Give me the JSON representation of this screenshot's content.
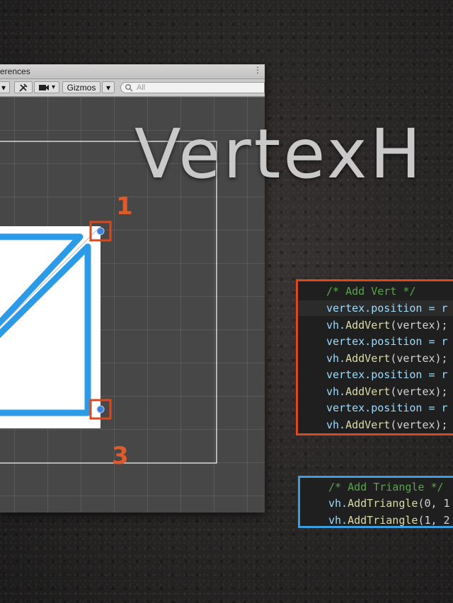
{
  "window": {
    "tab_title": "erences",
    "tab_menu_glyph": "⋮"
  },
  "toolbar": {
    "dropdown_glyph": "▾",
    "tools_icon": "tools-icon",
    "camera_icon": "camera-icon",
    "gizmos_label": "Gizmos",
    "search_placeholder": "All",
    "search_icon_glyph": "🔍"
  },
  "title": "VertexH",
  "annotations": {
    "label_1": "1",
    "label_3": "3"
  },
  "colors": {
    "vert_panel_border": "#d9481e",
    "triangle_panel_border": "#3a9ee0",
    "mesh_stroke": "#2b9be8",
    "vertex_marker_box": "#d9481e"
  },
  "code_vert": {
    "comment": "/* Add Vert */",
    "lines": [
      {
        "prefix": "vertex.position = r",
        "fn": "",
        "rest": ""
      },
      {
        "prefix": "vh.",
        "fn": "AddVert",
        "rest": "(vertex);"
      },
      {
        "prefix": "vertex.position = r",
        "fn": "",
        "rest": ""
      },
      {
        "prefix": "vh.",
        "fn": "AddVert",
        "rest": "(vertex);"
      },
      {
        "prefix": "vertex.position = r",
        "fn": "",
        "rest": ""
      },
      {
        "prefix": "vh.",
        "fn": "AddVert",
        "rest": "(vertex);"
      },
      {
        "prefix": "vertex.position = r",
        "fn": "",
        "rest": ""
      },
      {
        "prefix": "vh.",
        "fn": "AddVert",
        "rest": "(vertex);"
      }
    ]
  },
  "code_triangle": {
    "comment": "/* Add Triangle */",
    "lines": [
      {
        "prefix": "vh.",
        "fn": "AddTriangle",
        "rest": "(0, 1"
      },
      {
        "prefix": "vh.",
        "fn": "AddTriangle",
        "rest": "(1, 2"
      }
    ]
  }
}
